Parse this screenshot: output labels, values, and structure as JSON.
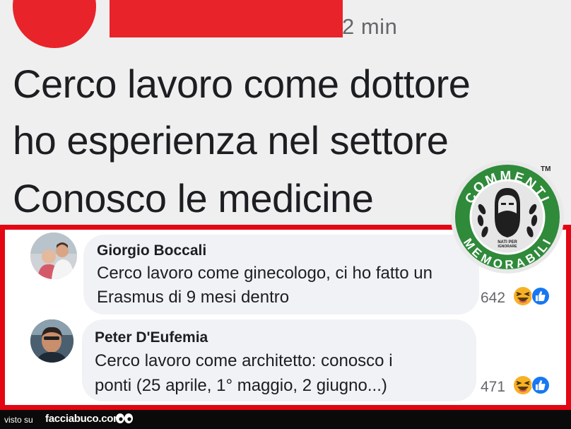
{
  "post": {
    "time": "2 min",
    "lines": [
      "Cerco lavoro come dottore",
      "ho esperienza nel settore",
      "Conosco le medicine"
    ]
  },
  "comments": [
    {
      "author": "Giorgio Boccali",
      "lines": [
        "Cerco lavoro come ginecologo, ci ho fatto un",
        "Erasmus di 9 mesi dentro"
      ],
      "reaction_count": "642"
    },
    {
      "author": "Peter D'Eufemia",
      "lines": [
        "Cerco lavoro come architetto: conosco i",
        "ponti (25 aprile, 1° maggio, 2 giugno...)"
      ],
      "reaction_count": "471"
    }
  ],
  "badge": {
    "top_text": "COMMENTI",
    "bottom_text": "MEMORABILI",
    "small_text_1": "NATI PER",
    "small_text_2": "IGNORARE",
    "trademark": "TM"
  },
  "footer": {
    "prefix": "visto su",
    "site": "facciabuco.com"
  },
  "colors": {
    "redaction": "#e8232a",
    "frame": "#e30613",
    "badge_green": "#2f8a3a",
    "like_blue": "#1877f2",
    "haha_yellow": "#f7b125"
  },
  "icons": [
    "haha-reaction-icon",
    "like-reaction-icon",
    "eyes-icon",
    "commenti-memorabili-badge"
  ]
}
